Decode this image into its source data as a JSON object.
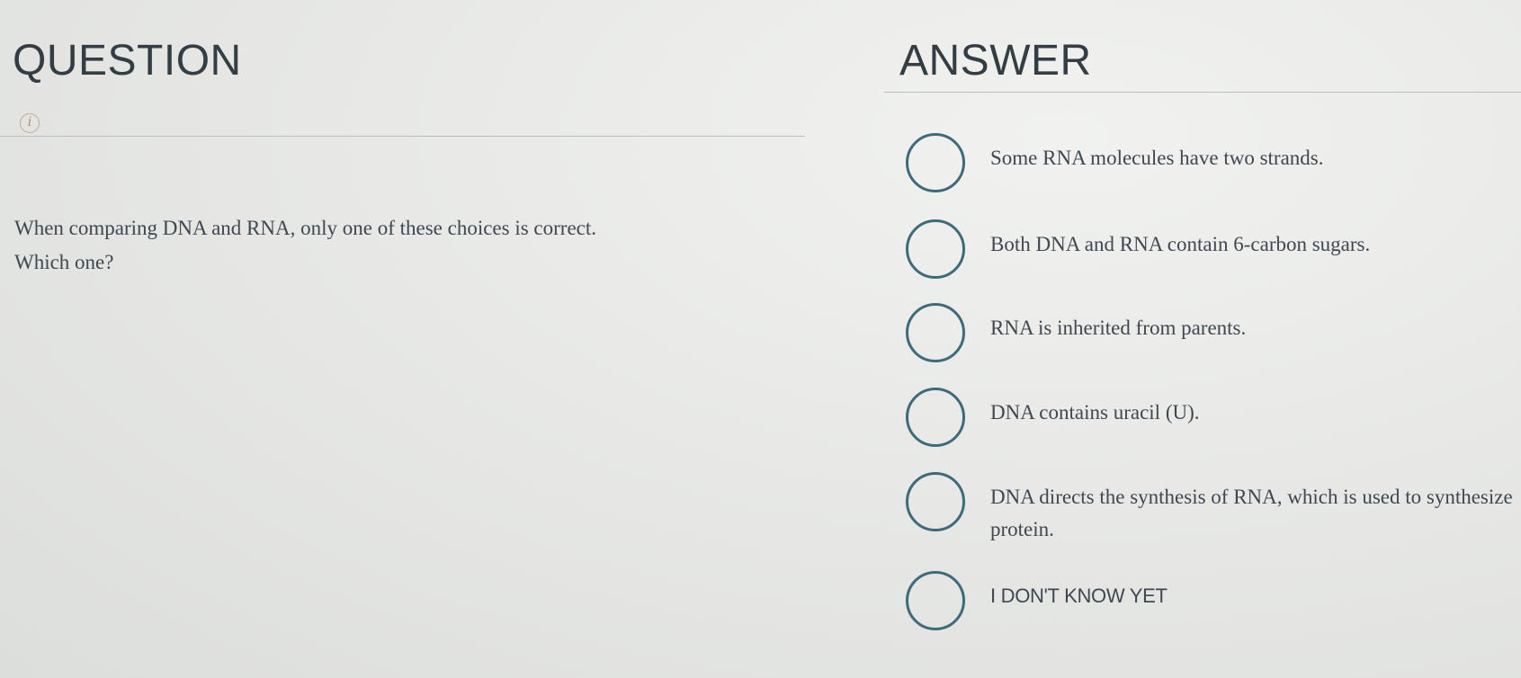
{
  "question": {
    "heading": "QUESTION",
    "info_icon": "info-icon",
    "text_line1": "When comparing DNA and RNA, only one of these choices is correct.",
    "text_line2": "Which one?"
  },
  "answer": {
    "heading": "ANSWER",
    "options": [
      {
        "label": "Some RNA molecules have two strands."
      },
      {
        "label": "Both DNA and RNA contain 6-carbon sugars."
      },
      {
        "label": "RNA is inherited from parents."
      },
      {
        "label": "DNA contains uracil (U)."
      },
      {
        "label": "DNA directs the synthesis of RNA, which is used to synthesize protein."
      },
      {
        "label": "I DON'T KNOW YET"
      }
    ]
  },
  "colors": {
    "radio_border": "#3e6b7a",
    "text": "#3d4850",
    "heading": "#323d44",
    "info_icon": "#c7a88c"
  }
}
